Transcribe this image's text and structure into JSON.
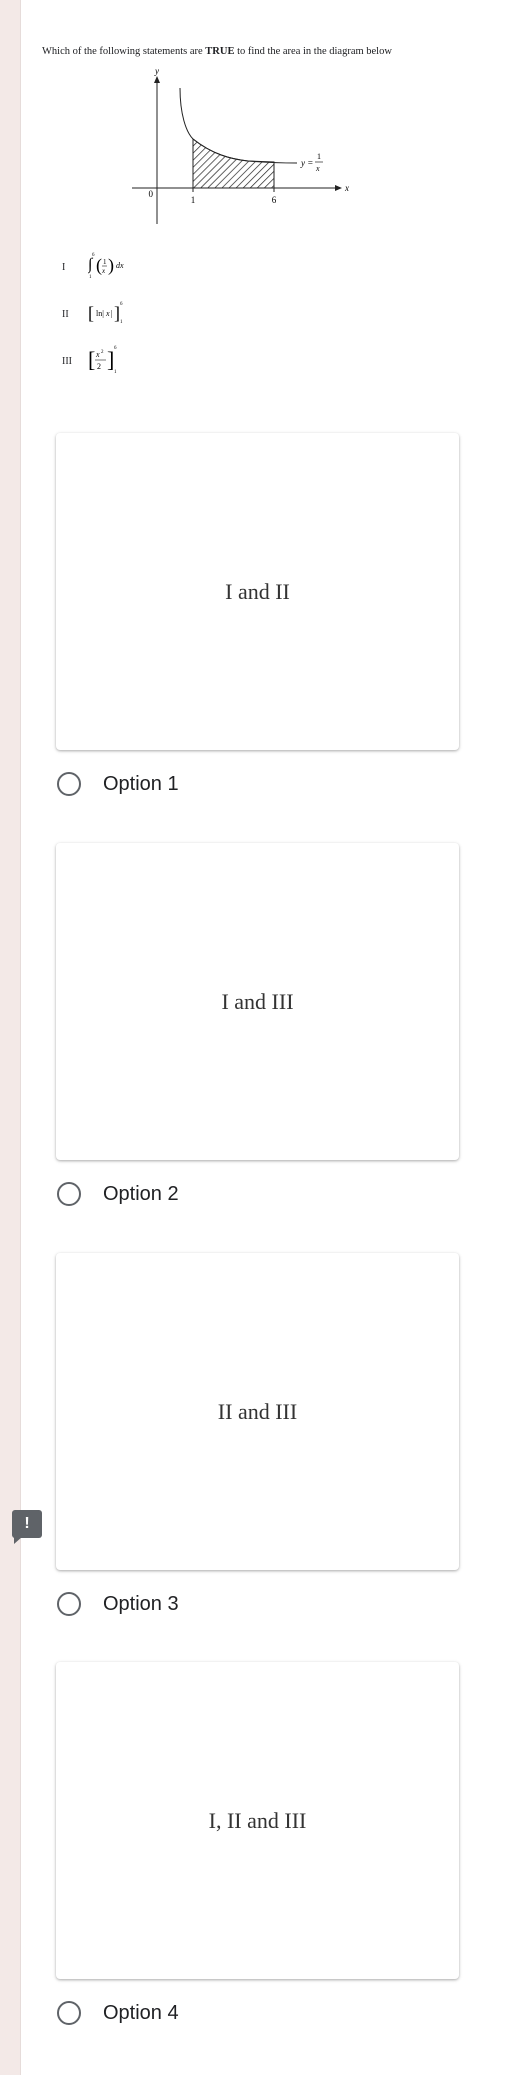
{
  "question": {
    "text_before": "Which of the following statements are ",
    "text_bold": "TRUE",
    "text_after": " to find the area in the diagram below",
    "graph": {
      "y_axis_label": "y",
      "x_axis_label": "x",
      "origin_label": "0",
      "tick_1": "1",
      "tick_6": "6",
      "curve_label_lhs": "y =",
      "curve_label_num": "1",
      "curve_label_den": "x"
    },
    "statements": [
      {
        "num": "I"
      },
      {
        "num": "II"
      },
      {
        "num": "III"
      }
    ]
  },
  "options": [
    {
      "image_text": "I and II",
      "label": "Option 1"
    },
    {
      "image_text": "I and III",
      "label": "Option 2"
    },
    {
      "image_text": "II and III",
      "label": "Option 3"
    },
    {
      "image_text": "I, II and III",
      "label": "Option 4"
    }
  ],
  "feedback": {
    "symbol": "!"
  }
}
